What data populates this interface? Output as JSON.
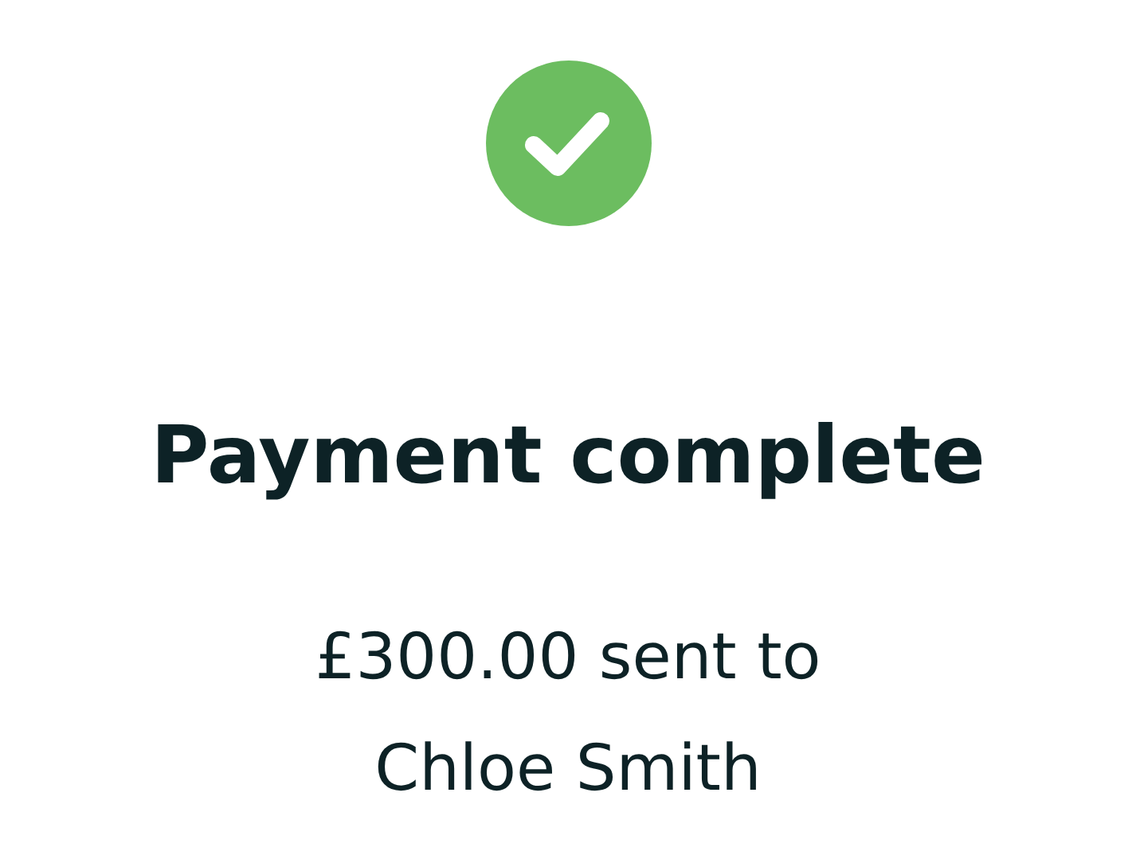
{
  "status": {
    "kind": "success"
  },
  "title": "Payment complete",
  "message": "£300.00 sent to Chloe Smith"
}
